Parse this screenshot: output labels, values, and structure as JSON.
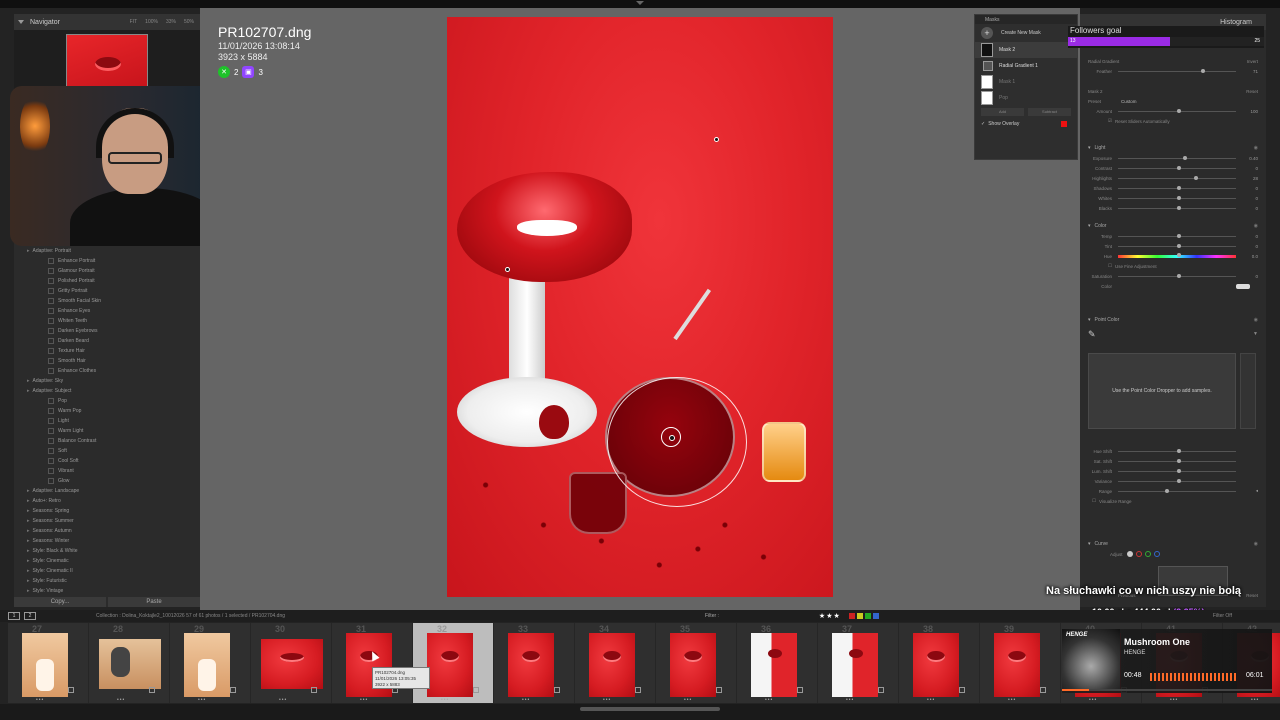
{
  "navigator": {
    "title": "Navigator",
    "zoom_options": [
      "FIT",
      "100%",
      "33%",
      "50%"
    ]
  },
  "presets": [
    {
      "type": "group",
      "label": "Adaptive: Portrait"
    },
    {
      "type": "item",
      "label": "Enhance Portrait"
    },
    {
      "type": "item",
      "label": "Glamour Portrait"
    },
    {
      "type": "item",
      "label": "Polished Portrait"
    },
    {
      "type": "item",
      "label": "Gritty Portrait"
    },
    {
      "type": "item",
      "label": "Smooth Facial Skin"
    },
    {
      "type": "item",
      "label": "Enhance Eyes"
    },
    {
      "type": "item",
      "label": "Whiten Teeth"
    },
    {
      "type": "item",
      "label": "Darken Eyebrows"
    },
    {
      "type": "item",
      "label": "Darken Beard"
    },
    {
      "type": "item",
      "label": "Texture Hair"
    },
    {
      "type": "item",
      "label": "Smooth Hair"
    },
    {
      "type": "item",
      "label": "Enhance Clothes"
    },
    {
      "type": "group",
      "label": "Adaptive: Sky"
    },
    {
      "type": "group",
      "label": "Adaptive: Subject"
    },
    {
      "type": "item",
      "label": "Pop"
    },
    {
      "type": "item",
      "label": "Warm Pop"
    },
    {
      "type": "item",
      "label": "Light"
    },
    {
      "type": "item",
      "label": "Warm Light"
    },
    {
      "type": "item",
      "label": "Balance Contrast"
    },
    {
      "type": "item",
      "label": "Soft"
    },
    {
      "type": "item",
      "label": "Cool Soft"
    },
    {
      "type": "item",
      "label": "Vibrant"
    },
    {
      "type": "item",
      "label": "Glow"
    },
    {
      "type": "group",
      "label": "Adaptive: Landscape"
    },
    {
      "type": "group",
      "label": "Auto+: Retro"
    },
    {
      "type": "group",
      "label": "Seasons: Spring"
    },
    {
      "type": "group",
      "label": "Seasons: Summer"
    },
    {
      "type": "group",
      "label": "Seasons: Autumn"
    },
    {
      "type": "group",
      "label": "Seasons: Winter"
    },
    {
      "type": "group",
      "label": "Style: Black & White"
    },
    {
      "type": "group",
      "label": "Style: Cinematic"
    },
    {
      "type": "group",
      "label": "Style: Cinematic II"
    },
    {
      "type": "group",
      "label": "Style: Futuristic"
    },
    {
      "type": "group",
      "label": "Style: Vintage"
    }
  ],
  "copy_label": "Copy...",
  "paste_label": "Paste",
  "image_info": {
    "filename": "PR102707.dng",
    "capture_date": "11/01/2026 13:08:14",
    "dimensions": "3923 x 5884",
    "xbox_count": "2",
    "twitch_count": "3"
  },
  "masks": {
    "title": "Masks",
    "create_label": "Create New Mask",
    "rows": [
      {
        "label": "Mask 2",
        "thumb": "black",
        "active": true
      },
      {
        "label": "Radial Gradient 1",
        "thumb": "icon",
        "active": false
      },
      {
        "label": "Mask 1",
        "thumb": "white",
        "active": false
      },
      {
        "label": "Pop",
        "thumb": "white",
        "active": false
      }
    ],
    "add_label": "Add",
    "subtract_label": "Subtract",
    "overlay_label": "Show Overlay",
    "overlay_color": "#e01010"
  },
  "right_panel": {
    "histogram_label": "Histogram",
    "radial_gradient_label": "Radial Gradient",
    "invert_label": "Invert",
    "feather_label": "Feather",
    "feather_value": "71",
    "mask_label": "Mask 2",
    "reset_label": "Reset",
    "preset_label": "Preset",
    "preset_value": "Custom",
    "amount_label": "Amount",
    "amount_value": "100",
    "reset_sliders_label": "Reset Sliders Automatically",
    "light_label": "Light",
    "light_rows": [
      {
        "label": "Exposure",
        "value": "0.40",
        "pos": 0.55
      },
      {
        "label": "Contrast",
        "value": "0",
        "pos": 0.5
      },
      {
        "label": "Highlights",
        "value": "28",
        "pos": 0.64
      },
      {
        "label": "Shadows",
        "value": "0",
        "pos": 0.5
      },
      {
        "label": "Whites",
        "value": "0",
        "pos": 0.5
      },
      {
        "label": "Blacks",
        "value": "0",
        "pos": 0.5
      }
    ],
    "color_label": "Color",
    "color_rows": [
      {
        "label": "Temp",
        "value": "0",
        "pos": 0.5
      },
      {
        "label": "Tint",
        "value": "0",
        "pos": 0.5
      },
      {
        "label": "Hue",
        "value": "0.0",
        "pos": 0.5
      }
    ],
    "fine_label": "Use Fine Adjustment",
    "saturation_label": "Saturation",
    "saturation_value": "0",
    "color_swatch_label": "Color",
    "point_color_label": "Point Color",
    "point_color_hint": "Use the Point Color Dropper to add samples.",
    "pc_rows": [
      {
        "label": "Hue Shift"
      },
      {
        "label": "Sat. Shift"
      },
      {
        "label": "Lum. Shift"
      },
      {
        "label": "Variance"
      }
    ],
    "range_label": "Range",
    "visualize_label": "Visualize Range",
    "curve_label": "Curve",
    "adjust_label": "Adjust",
    "previous_label": "Previous",
    "reset_bottom_label": "Reset"
  },
  "followers_goal": {
    "label": "Followers goal",
    "current": "13",
    "goal": "25",
    "progress": 0.52,
    "color": "#9a2be6"
  },
  "caption": "Na słuchawki co w nich uszy nie bolą",
  "donation": {
    "text": "10,00 zł z 444,00 zł",
    "percent": "(2.25%)"
  },
  "strip_bar": {
    "page_1": "1",
    "page_2": "2",
    "path": "Collection : Dolina_Koktajle2_10012026  57 of 61 photos / 1 selected / PR102704.dng",
    "filter_label": "Filter :",
    "stars": "★★★",
    "filter_off": "Filter Off"
  },
  "filmstrip": [
    {
      "num": "27",
      "style": "t-peach",
      "wide": false
    },
    {
      "num": "28",
      "style": "t-silver",
      "wide": true
    },
    {
      "num": "29",
      "style": "t-peach",
      "wide": false
    },
    {
      "num": "30",
      "style": "t-red",
      "wide": true
    },
    {
      "num": "31",
      "style": "t-red",
      "wide": false
    },
    {
      "num": "32",
      "style": "t-red",
      "wide": false,
      "selected": true
    },
    {
      "num": "33",
      "style": "t-red",
      "wide": false
    },
    {
      "num": "34",
      "style": "t-red",
      "wide": false
    },
    {
      "num": "35",
      "style": "t-red",
      "wide": false
    },
    {
      "num": "36",
      "style": "t-white-red",
      "wide": false
    },
    {
      "num": "37",
      "style": "t-white-red",
      "wide": false
    },
    {
      "num": "38",
      "style": "t-red",
      "wide": false
    },
    {
      "num": "39",
      "style": "t-red",
      "wide": false
    },
    {
      "num": "40",
      "style": "t-red",
      "wide": false
    },
    {
      "num": "41",
      "style": "t-red",
      "wide": false
    },
    {
      "num": "42",
      "style": "t-red",
      "wide": false
    }
  ],
  "tooltip": {
    "name": "PR102704.dng",
    "date": "11/01/2026 13:05:35",
    "dims": "3922 x 5883"
  },
  "music": {
    "cover_label": "HENGE",
    "song": "Mushroom One",
    "artist": "HENGE",
    "elapsed": "00:48",
    "total": "06:01",
    "progress": 0.13
  }
}
